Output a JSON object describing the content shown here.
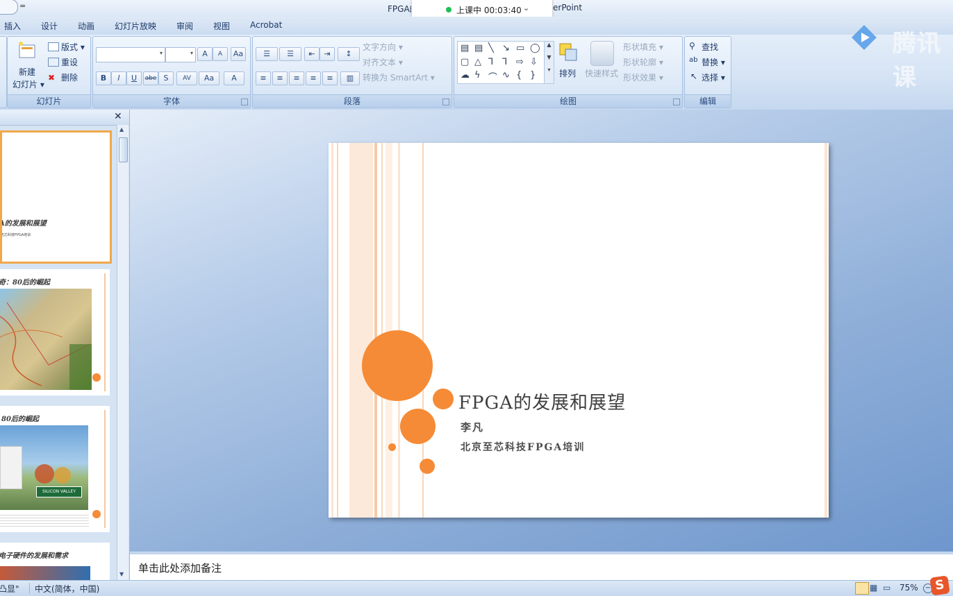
{
  "titlebar": {
    "title_left": "FPGA的",
    "title_right": "erPoint",
    "class_status": "上课中 00:03:40",
    "class_chevron": "⌄",
    "qa_arrow": "="
  },
  "menu_tabs": [
    "插入",
    "设计",
    "动画",
    "幻灯片放映",
    "审阅",
    "视图",
    "Acrobat"
  ],
  "ribbon": {
    "slides_group": {
      "label": "幻灯片",
      "new_slide": "新建",
      "new_slide2": "幻灯片 ▾",
      "layout": "版式 ▾",
      "reset": "重设",
      "delete": "删除"
    },
    "font_group": {
      "label": "字体",
      "grow": "A",
      "shrink": "A",
      "clear": "Aa",
      "bold": "B",
      "italic": "I",
      "underline": "U",
      "strike": "abe",
      "shadow": "S",
      "spacing": "AV",
      "case": "Aa",
      "color": "A"
    },
    "paragraph_group": {
      "label": "段落",
      "text_direction": "文字方向 ▾",
      "align_text": "对齐文本 ▾",
      "smartart": "转换为 SmartArt ▾"
    },
    "drawing_group": {
      "label": "绘图",
      "arrange": "排列",
      "quick_styles": "快速样式",
      "shape_fill": "形状填充 ▾",
      "shape_outline": "形状轮廓 ▾",
      "shape_effects": "形状效果 ▾"
    },
    "editing_group": {
      "label": "编辑",
      "find": "查找",
      "replace": "替换 ▾",
      "select": "选择 ▾"
    }
  },
  "logo": {
    "text": "腾讯课"
  },
  "slide_pane": {
    "close": "✕",
    "thumbs": [
      {
        "title": "A的发展和展望",
        "sub": "志芯科技FPGA培训"
      },
      {
        "title": "奇：80后的崛起"
      },
      {
        "title": "80后的崛起",
        "sign": "SILICON VALLEY"
      },
      {
        "title": "电子硬件的发展和需求"
      }
    ]
  },
  "slide": {
    "title": "FPGA的发展和展望",
    "author": "李凡",
    "organization": "北京至芯科技FPGA培训",
    "accent_color": "#f58b36"
  },
  "notes": {
    "placeholder": "单击此处添加备注"
  },
  "statusbar": {
    "theme": "凸显\"",
    "language": "中文(简体，中国)",
    "zoom": "75%"
  }
}
